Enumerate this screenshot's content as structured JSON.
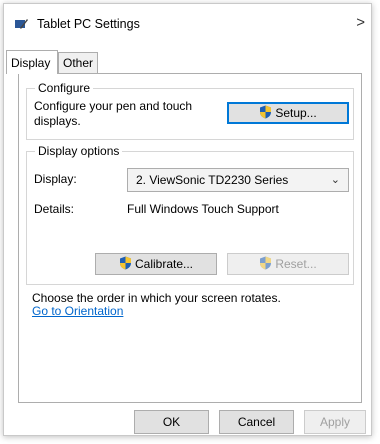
{
  "window": {
    "title": "Tablet PC Settings",
    "close_glyph": ">"
  },
  "tabs": [
    {
      "label": "Display"
    },
    {
      "label": "Other"
    }
  ],
  "configure": {
    "legend": "Configure",
    "description": "Configure your pen and touch displays.",
    "setup_label": "Setup..."
  },
  "display_options": {
    "legend": "Display options",
    "display_label": "Display:",
    "display_value": "2. ViewSonic TD2230 Series",
    "details_label": "Details:",
    "details_value": "Full Windows Touch Support",
    "calibrate_label": "Calibrate...",
    "reset_label": "Reset..."
  },
  "orientation": {
    "text": "Choose the order in which your screen rotates.",
    "link": "Go to Orientation"
  },
  "footer": {
    "ok_label": "OK",
    "cancel_label": "Cancel",
    "apply_label": "Apply"
  },
  "icons": {
    "app": "tablet-pc-settings-icon",
    "uac": "uac-shield-icon"
  },
  "colors": {
    "accent": "#0078d7",
    "link": "#0066cc"
  }
}
